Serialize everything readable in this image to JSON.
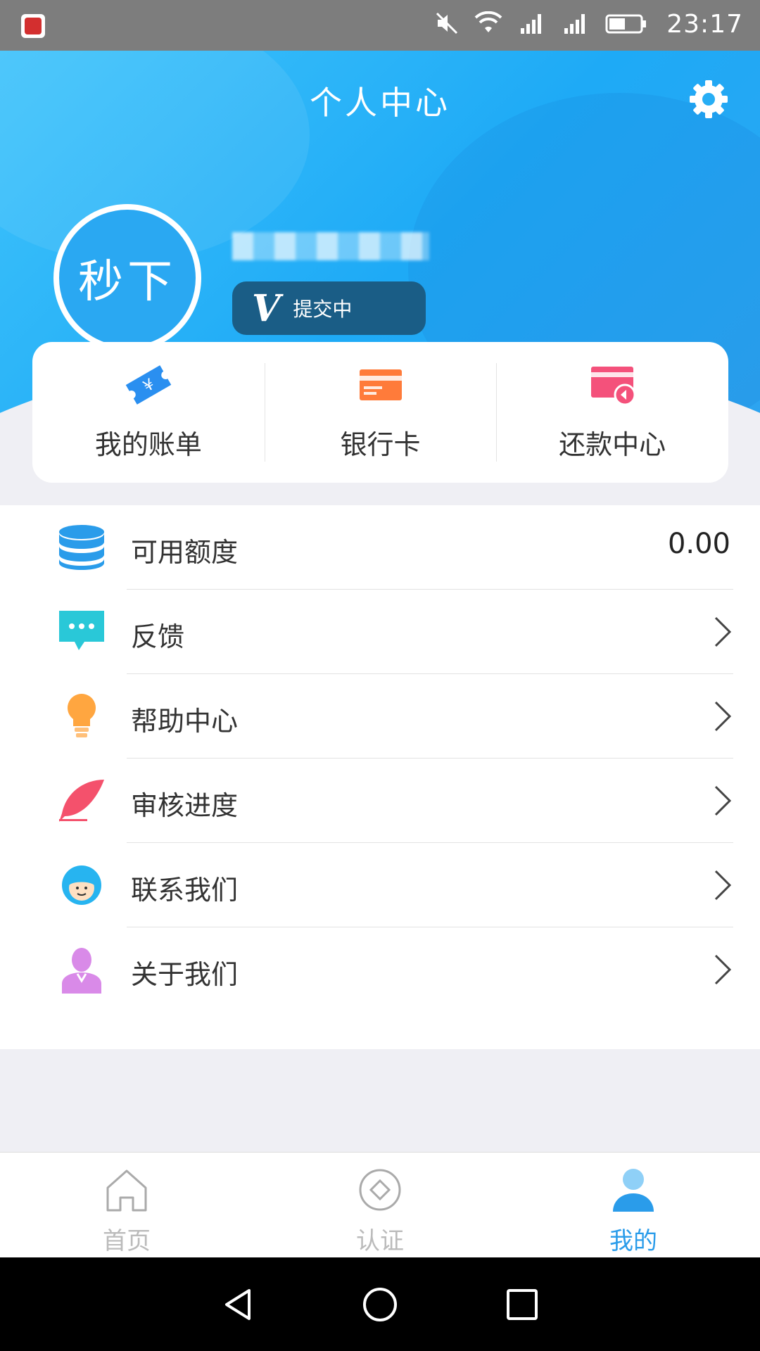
{
  "status_bar": {
    "time": "23:17",
    "icons": [
      "app-icon",
      "mute-icon",
      "wifi-icon",
      "signal-2g-icon",
      "signal-4g-icon",
      "battery-icon"
    ]
  },
  "header": {
    "title": "个人中心",
    "settings_icon": "gear-icon",
    "avatar_text": "秒下",
    "badge_text": "提交中",
    "badge_icon": "v-icon"
  },
  "quick_actions": [
    {
      "label": "我的账单",
      "icon": "bill-ticket-icon"
    },
    {
      "label": "银行卡",
      "icon": "bank-card-icon"
    },
    {
      "label": "还款中心",
      "icon": "repay-card-icon"
    }
  ],
  "menu": [
    {
      "label": "可用额度",
      "value": "0.00",
      "icon": "database-icon"
    },
    {
      "label": "反馈",
      "icon": "chat-bubble-icon"
    },
    {
      "label": "帮助中心",
      "icon": "lightbulb-icon"
    },
    {
      "label": "审核进度",
      "icon": "feather-icon"
    },
    {
      "label": "联系我们",
      "icon": "headset-agent-icon"
    },
    {
      "label": "关于我们",
      "icon": "person-icon"
    }
  ],
  "tabs": [
    {
      "label": "首页",
      "icon": "home-icon",
      "active": false
    },
    {
      "label": "认证",
      "icon": "diamond-circle-icon",
      "active": false
    },
    {
      "label": "我的",
      "icon": "user-icon",
      "active": true
    }
  ],
  "colors": {
    "primary": "#2a9cea",
    "hero_blue": "#29b0f7",
    "badge_bg": "#1a5d86",
    "bill_icon": "#2a8ff0",
    "card_icon": "#ff7b3a",
    "repay_icon": "#f4517b",
    "feedback_icon": "#29c8d8",
    "help_icon": "#ffa640",
    "progress_icon": "#f4516c",
    "contact_icon": "#27b4f0",
    "about_icon": "#d98ae8"
  }
}
